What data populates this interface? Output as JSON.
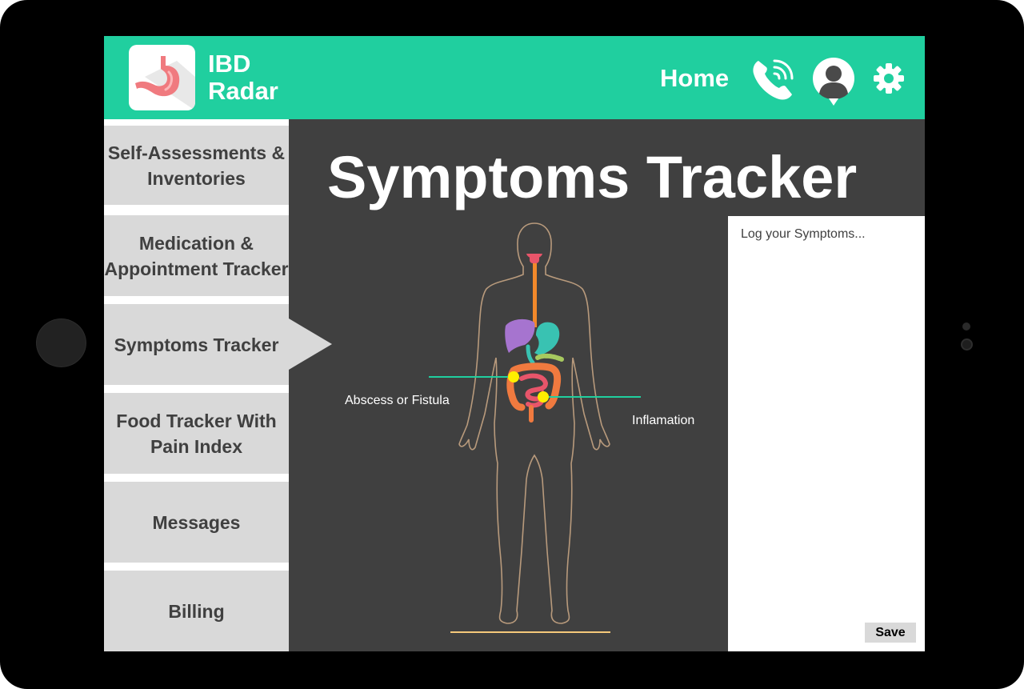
{
  "app": {
    "title_line1": "IBD",
    "title_line2": "Radar"
  },
  "header": {
    "home_label": "Home"
  },
  "sidebar": {
    "items": [
      {
        "line1": "Self-Assessments &",
        "line2": "Inventories"
      },
      {
        "line1": "Medication &",
        "line2": "Appointment Tracker"
      },
      {
        "line1": "Symptoms Tracker",
        "line2": ""
      },
      {
        "line1": "Food Tracker With",
        "line2": "Pain Index"
      },
      {
        "line1": "Messages",
        "line2": ""
      },
      {
        "line1": "Billing",
        "line2": ""
      }
    ],
    "active_index": 2
  },
  "main": {
    "title": "Symptoms Tracker",
    "annotations": {
      "abscess": "Abscess or Fistula",
      "inflammation": "Inflamation"
    }
  },
  "log": {
    "placeholder": "Log your Symptoms...",
    "save_label": "Save"
  },
  "colors": {
    "header": "#20cf9f",
    "content_bg": "#404040",
    "sidebar_item": "#d9d9d9",
    "marker": "#ffee00",
    "pointer_line": "#20cf9f"
  }
}
